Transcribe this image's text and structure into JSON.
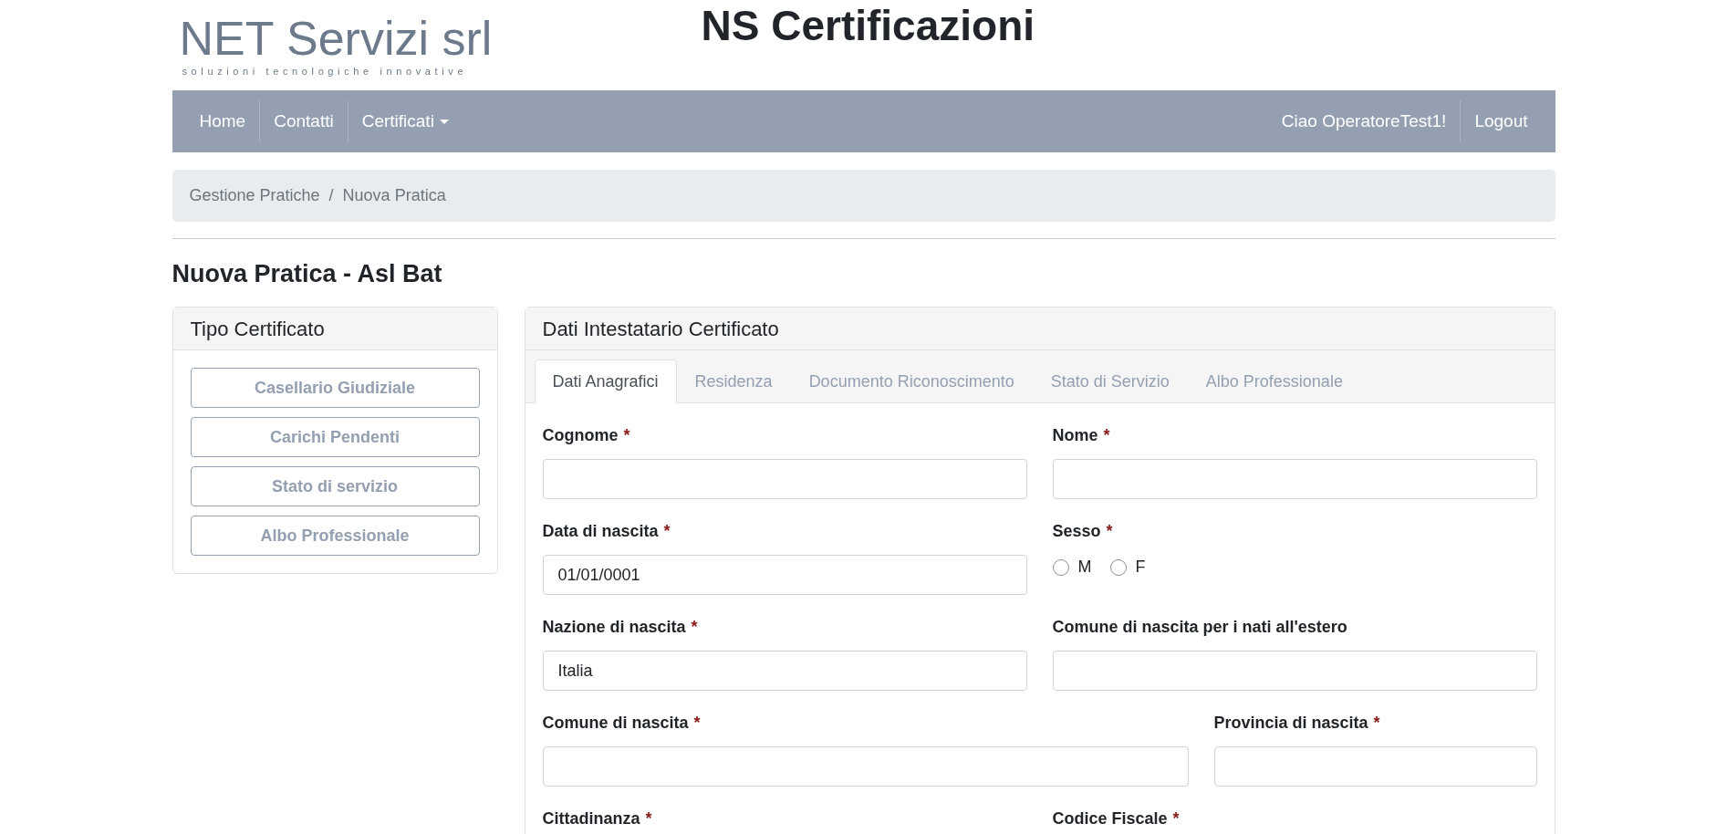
{
  "logo": {
    "name": "NET Servizi srl",
    "tagline": "soluzioni tecnologiche innovative"
  },
  "site_title": "NS Certificazioni",
  "navbar": {
    "left": [
      {
        "label": "Home",
        "dropdown": false
      },
      {
        "label": "Contatti",
        "dropdown": false
      },
      {
        "label": "Certificati",
        "dropdown": true
      }
    ],
    "right": [
      {
        "label": "Ciao OperatoreTest1!"
      },
      {
        "label": "Logout"
      }
    ]
  },
  "breadcrumb": {
    "separator": "/",
    "items": [
      "Gestione Pratiche",
      "Nuova Pratica"
    ]
  },
  "page_title": "Nuova Pratica - Asl Bat",
  "tipo_certificato": {
    "title": "Tipo Certificato",
    "buttons": [
      "Casellario Giudiziale",
      "Carichi Pendenti",
      "Stato di servizio",
      "Albo Professionale"
    ]
  },
  "dati_intestatario": {
    "title": "Dati Intestatario Certificato",
    "tabs": [
      {
        "label": "Dati Anagrafici",
        "selected": true
      },
      {
        "label": "Residenza",
        "selected": false
      },
      {
        "label": "Documento Riconoscimento",
        "selected": false
      },
      {
        "label": "Stato di Servizio",
        "selected": false
      },
      {
        "label": "Albo Professionale",
        "selected": false
      }
    ],
    "rows": [
      {
        "kind": "half",
        "fields": [
          {
            "kind": "text",
            "label": "Cognome",
            "required_mark": "*"
          },
          {
            "kind": "text",
            "label": "Nome",
            "required_mark": "*"
          }
        ]
      },
      {
        "kind": "half",
        "fields": [
          {
            "kind": "text",
            "label": "Data di nascita",
            "required_mark": "*",
            "value": "01/01/0001"
          },
          {
            "kind": "radio",
            "label": "Sesso",
            "required_mark": "*",
            "options": [
              {
                "label": "M",
                "selected": false
              },
              {
                "label": "F",
                "selected": false
              }
            ]
          }
        ]
      },
      {
        "kind": "half",
        "fields": [
          {
            "kind": "text",
            "label": "Nazione di nascita",
            "required_mark": "*",
            "value": "Italia"
          },
          {
            "kind": "text",
            "label": "Comune di nascita per i nati all'estero"
          }
        ]
      },
      {
        "kind": "wide",
        "fields": [
          {
            "kind": "text",
            "label": "Comune di nascita",
            "required_mark": "*"
          },
          {
            "kind": "text",
            "label": "Provincia di nascita",
            "required_mark": "*"
          }
        ]
      },
      {
        "kind": "half",
        "fields": [
          {
            "kind": "text",
            "label": "Cittadinanza",
            "required_mark": "*"
          },
          {
            "kind": "text",
            "label": "Codice Fiscale",
            "required_mark": "*"
          }
        ]
      }
    ]
  }
}
